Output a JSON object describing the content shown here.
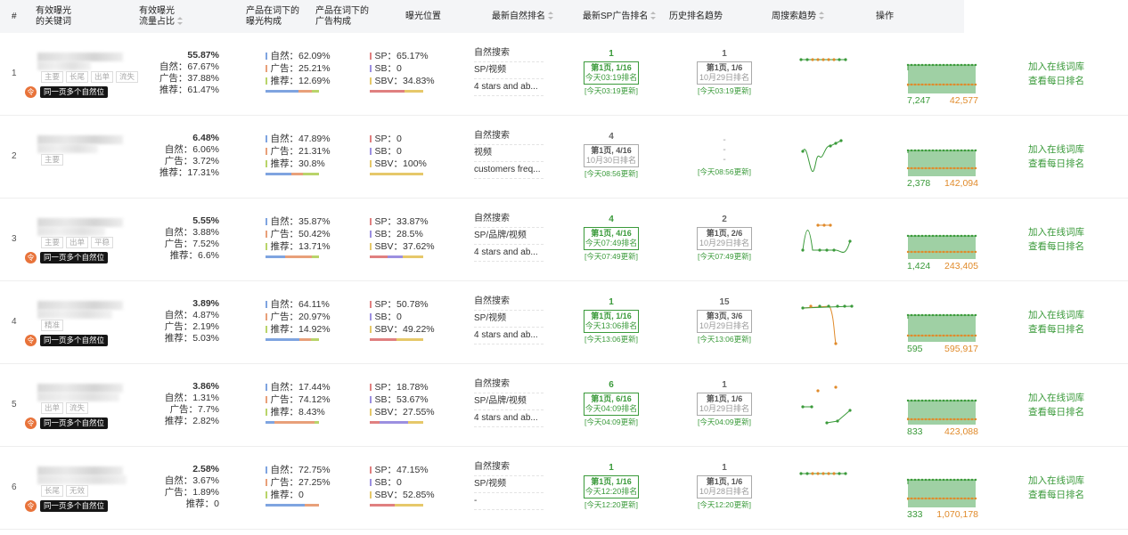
{
  "headers": {
    "idx": "#",
    "keyword_l1": "有效曝光",
    "keyword_l2": "的关键词",
    "share_l1": "有效曝光",
    "share_l2": "流量占比",
    "comp_l1": "产品在词下的",
    "comp_l2": "曝光构成",
    "ad_l1": "产品在词下的",
    "ad_l2": "广告构成",
    "position": "曝光位置",
    "organic_rank": "最新自然排名",
    "sp_rank": "最新SP广告排名",
    "history": "历史排名趋势",
    "weekly": "周搜索趋势",
    "ops": "操作"
  },
  "colors": {
    "green": "#3a9a3a",
    "orange": "#e08a2a",
    "bar_natural": "#7fa4e0",
    "bar_ad": "#e8a07a",
    "bar_rec": "#b9d46a",
    "bar_sp": "#e08080",
    "bar_sb": "#9c8fe0",
    "bar_sbv": "#e6c86a"
  },
  "rows": [
    {
      "idx": "1",
      "tags": [
        "主要",
        "长尾",
        "出单",
        "流失"
      ],
      "badge": "同一页多个自然位",
      "has_badge": true,
      "share_top": "55.87%",
      "share_nat": "自然：67.67%",
      "share_ad": "广告：37.88%",
      "share_rec": "推荐：61.47%",
      "comp_nat": "自然：62.09%",
      "comp_ad": "广告：25.21%",
      "comp_rec": "推荐：12.69%",
      "comp_w": [
        62.09,
        25.21,
        12.69
      ],
      "ad_sp": "SP：65.17%",
      "ad_sb": "SB：0",
      "ad_sbv": "SBV：34.83%",
      "ad_w": [
        65.17,
        0,
        34.83
      ],
      "pos": [
        "自然搜索",
        "SP/视频",
        "4 stars and ab..."
      ],
      "org_type": "green",
      "org_n": "1",
      "org_box": "第1页, 1/16",
      "org_box2": "今天03:19排名",
      "org_up": "[今天03:19更新]",
      "sp_type": "grey",
      "sp_n": "1",
      "sp_box": "第1页, 1/6",
      "sp_box2": "10月29日排名",
      "sp_up": "[今天03:19更新]",
      "spark": "flat_orange",
      "w_a": "7,247",
      "w_b": "42,577"
    },
    {
      "idx": "2",
      "tags": [
        "主要"
      ],
      "badge": "",
      "has_badge": false,
      "share_top": "6.48%",
      "share_nat": "自然：6.06%",
      "share_ad": "广告：3.72%",
      "share_rec": "推荐：17.31%",
      "comp_nat": "自然：47.89%",
      "comp_ad": "广告：21.31%",
      "comp_rec": "推荐：30.8%",
      "comp_w": [
        47.89,
        21.31,
        30.8
      ],
      "ad_sp": "SP：0",
      "ad_sb": "SB：0",
      "ad_sbv": "SBV：100%",
      "ad_w": [
        0,
        0,
        100
      ],
      "pos": [
        "自然搜索",
        "视频",
        "customers freq..."
      ],
      "org_type": "grey",
      "org_n": "4",
      "org_box": "第1页, 4/16",
      "org_box2": "10月30日排名",
      "org_up": "[今天08:56更新]",
      "sp_type": "dash",
      "sp_n": "-",
      "sp_box": "-",
      "sp_box2": "-",
      "sp_up": "[今天08:56更新]",
      "spark": "dip",
      "w_a": "2,378",
      "w_b": "142,094"
    },
    {
      "idx": "3",
      "tags": [
        "主要",
        "出单",
        "平稳"
      ],
      "badge": "同一页多个自然位",
      "has_badge": true,
      "share_top": "5.55%",
      "share_nat": "自然：3.88%",
      "share_ad": "广告：7.52%",
      "share_rec": "推荐：6.6%",
      "comp_nat": "自然：35.87%",
      "comp_ad": "广告：50.42%",
      "comp_rec": "推荐：13.71%",
      "comp_w": [
        35.87,
        50.42,
        13.71
      ],
      "ad_sp": "SP：33.87%",
      "ad_sb": "SB：28.5%",
      "ad_sbv": "SBV：37.62%",
      "ad_w": [
        33.87,
        28.5,
        37.62
      ],
      "pos": [
        "自然搜索",
        "SP/品牌/视频",
        "4 stars and ab..."
      ],
      "org_type": "green",
      "org_n": "4",
      "org_box": "第1页, 4/16",
      "org_box2": "今天07:49排名",
      "org_up": "[今天07:49更新]",
      "sp_type": "grey",
      "sp_n": "2",
      "sp_box": "第1页, 2/6",
      "sp_box2": "10月29日排名",
      "sp_up": "[今天07:49更新]",
      "spark": "wave",
      "w_a": "1,424",
      "w_b": "243,405"
    },
    {
      "idx": "4",
      "tags": [
        "精准"
      ],
      "badge": "同一页多个自然位",
      "has_badge": true,
      "share_top": "3.89%",
      "share_nat": "自然：4.87%",
      "share_ad": "广告：2.19%",
      "share_rec": "推荐：5.03%",
      "comp_nat": "自然：64.11%",
      "comp_ad": "广告：20.97%",
      "comp_rec": "推荐：14.92%",
      "comp_w": [
        64.11,
        20.97,
        14.92
      ],
      "ad_sp": "SP：50.78%",
      "ad_sb": "SB：0",
      "ad_sbv": "SBV：49.22%",
      "ad_w": [
        50.78,
        0,
        49.22
      ],
      "pos": [
        "自然搜索",
        "SP/视频",
        "4 stars and ab..."
      ],
      "org_type": "green",
      "org_n": "1",
      "org_box": "第1页, 1/16",
      "org_box2": "今天13:06排名",
      "org_up": "[今天13:06更新]",
      "sp_type": "grey",
      "sp_n": "15",
      "sp_box": "第3页, 3/6",
      "sp_box2": "10月29日排名",
      "sp_up": "[今天13:06更新]",
      "spark": "drop",
      "w_a": "595",
      "w_b": "595,917"
    },
    {
      "idx": "5",
      "tags": [
        "出单",
        "流失"
      ],
      "badge": "同一页多个自然位",
      "has_badge": true,
      "share_top": "3.86%",
      "share_nat": "自然：1.31%",
      "share_ad": "广告：7.7%",
      "share_rec": "推荐：2.82%",
      "comp_nat": "自然：17.44%",
      "comp_ad": "广告：74.12%",
      "comp_rec": "推荐：8.43%",
      "comp_w": [
        17.44,
        74.12,
        8.43
      ],
      "ad_sp": "SP：18.78%",
      "ad_sb": "SB：53.67%",
      "ad_sbv": "SBV：27.55%",
      "ad_w": [
        18.78,
        53.67,
        27.55
      ],
      "pos": [
        "自然搜索",
        "SP/品牌/视频",
        "4 stars and ab..."
      ],
      "org_type": "green",
      "org_n": "6",
      "org_box": "第1页, 6/16",
      "org_box2": "今天04:09排名",
      "org_up": "[今天04:09更新]",
      "sp_type": "grey",
      "sp_n": "1",
      "sp_box": "第1页, 1/6",
      "sp_box2": "10月29日排名",
      "sp_up": "[今天04:09更新]",
      "spark": "scatter",
      "w_a": "833",
      "w_b": "423,088"
    },
    {
      "idx": "6",
      "tags": [
        "长尾",
        "无效"
      ],
      "badge": "同一页多个自然位",
      "has_badge": true,
      "share_top": "2.58%",
      "share_nat": "自然：3.67%",
      "share_ad": "广告：1.89%",
      "share_rec": "推荐：0",
      "comp_nat": "自然：72.75%",
      "comp_ad": "广告：27.25%",
      "comp_rec": "推荐：0",
      "comp_w": [
        72.75,
        27.25,
        0
      ],
      "ad_sp": "SP：47.15%",
      "ad_sb": "SB：0",
      "ad_sbv": "SBV：52.85%",
      "ad_w": [
        47.15,
        0,
        52.85
      ],
      "pos": [
        "自然搜索",
        "SP/视频",
        "-"
      ],
      "org_type": "green",
      "org_n": "1",
      "org_box": "第1页, 1/16",
      "org_box2": "今天12:20排名",
      "org_up": "[今天12:20更新]",
      "sp_type": "grey",
      "sp_n": "1",
      "sp_box": "第1页, 1/6",
      "sp_box2": "10月28日排名",
      "sp_up": "[今天12:20更新]",
      "spark": "flat_orange",
      "w_a": "333",
      "w_b": "1,070,178"
    }
  ],
  "ops": {
    "add": "加入在线词库",
    "daily": "查看每日排名"
  }
}
